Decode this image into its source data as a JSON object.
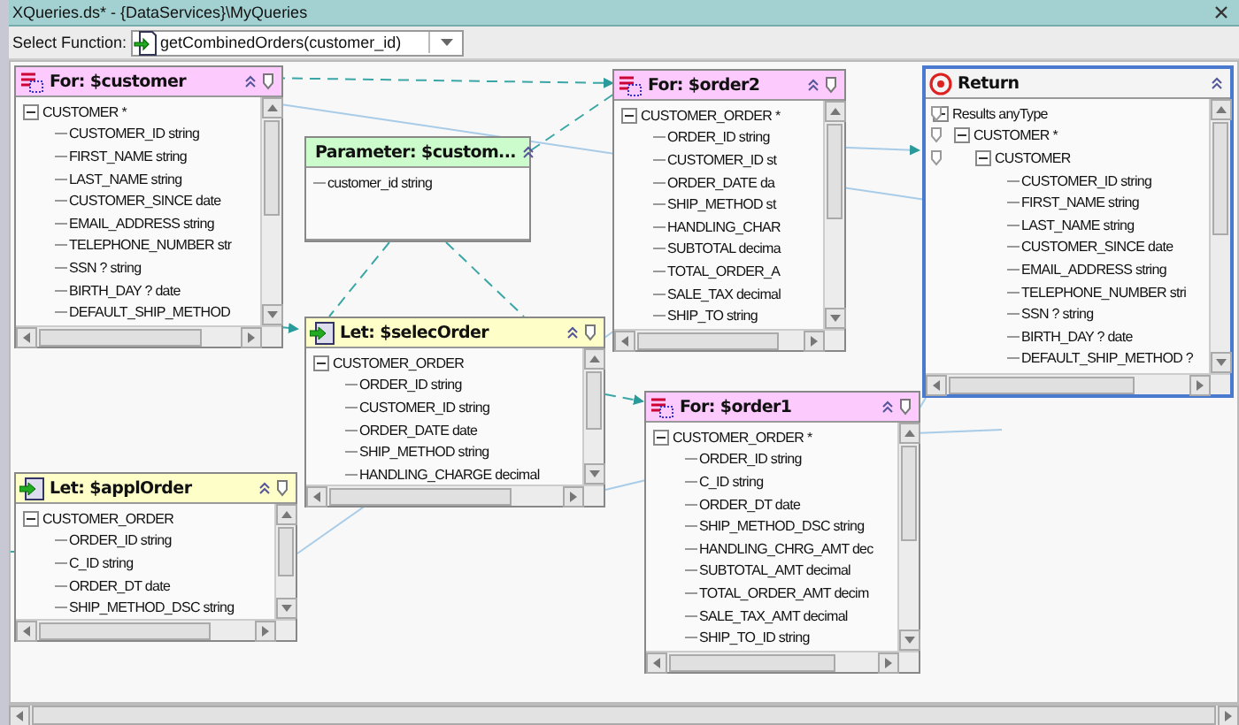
{
  "window": {
    "title": "XQueries.ds* - {DataServices}\\MyQueries"
  },
  "toolbar": {
    "label": "Select Function:",
    "function": "getCombinedOrders(customer_id)"
  },
  "nodes": [
    {
      "kind": "for",
      "title": "For: $customer",
      "tree": [
        {
          "label": "CUSTOMER *",
          "expanded": true,
          "children": [
            {
              "label": "CUSTOMER_ID string"
            },
            {
              "label": "FIRST_NAME string"
            },
            {
              "label": "LAST_NAME string"
            },
            {
              "label": "CUSTOMER_SINCE date"
            },
            {
              "label": "EMAIL_ADDRESS string"
            },
            {
              "label": "TELEPHONE_NUMBER str"
            },
            {
              "label": "SSN ? string"
            },
            {
              "label": "BIRTH_DAY ? date"
            },
            {
              "label": "DEFAULT_SHIP_METHOD"
            }
          ]
        }
      ]
    },
    {
      "kind": "parameter",
      "title": "Parameter: $custom...",
      "tree": [
        {
          "label": "customer_id string"
        }
      ]
    },
    {
      "kind": "let",
      "title": "Let: $selecOrder",
      "tree": [
        {
          "label": "CUSTOMER_ORDER",
          "expanded": true,
          "children": [
            {
              "label": "ORDER_ID string"
            },
            {
              "label": "CUSTOMER_ID string"
            },
            {
              "label": "ORDER_DATE date"
            },
            {
              "label": "SHIP_METHOD string"
            },
            {
              "label": "HANDLING_CHARGE decimal"
            }
          ]
        }
      ]
    },
    {
      "kind": "let",
      "title": "Let: $applOrder",
      "tree": [
        {
          "label": "CUSTOMER_ORDER",
          "expanded": true,
          "children": [
            {
              "label": "ORDER_ID string"
            },
            {
              "label": "C_ID string"
            },
            {
              "label": "ORDER_DT date"
            },
            {
              "label": "SHIP_METHOD_DSC string"
            }
          ]
        }
      ]
    },
    {
      "kind": "for",
      "title": "For: $order2",
      "tree": [
        {
          "label": "CUSTOMER_ORDER *",
          "expanded": true,
          "children": [
            {
              "label": "ORDER_ID string"
            },
            {
              "label": "CUSTOMER_ID st"
            },
            {
              "label": "ORDER_DATE da"
            },
            {
              "label": "SHIP_METHOD st"
            },
            {
              "label": "HANDLING_CHAR"
            },
            {
              "label": "SUBTOTAL decima"
            },
            {
              "label": "TOTAL_ORDER_A"
            },
            {
              "label": "SALE_TAX decimal"
            },
            {
              "label": "SHIP_TO string"
            }
          ]
        }
      ]
    },
    {
      "kind": "return",
      "title": "Return",
      "tree": [
        {
          "label": "Results anyType",
          "expanded": true,
          "children": [
            {
              "label": "CUSTOMER *",
              "expanded": true,
              "children": [
                {
                  "label": "CUSTOMER",
                  "expanded": true,
                  "children": [
                    {
                      "label": "CUSTOMER_ID string"
                    },
                    {
                      "label": "FIRST_NAME string"
                    },
                    {
                      "label": "LAST_NAME string"
                    },
                    {
                      "label": "CUSTOMER_SINCE date"
                    },
                    {
                      "label": "EMAIL_ADDRESS string"
                    },
                    {
                      "label": "TELEPHONE_NUMBER stri"
                    },
                    {
                      "label": "SSN ? string"
                    },
                    {
                      "label": "BIRTH_DAY ? date"
                    },
                    {
                      "label": "DEFAULT_SHIP_METHOD ?"
                    }
                  ]
                }
              ]
            }
          ]
        }
      ]
    },
    {
      "kind": "for",
      "title": "For: $order1",
      "tree": [
        {
          "label": "CUSTOMER_ORDER *",
          "expanded": true,
          "children": [
            {
              "label": "ORDER_ID string"
            },
            {
              "label": "C_ID string"
            },
            {
              "label": "ORDER_DT date"
            },
            {
              "label": "SHIP_METHOD_DSC string"
            },
            {
              "label": "HANDLING_CHRG_AMT dec"
            },
            {
              "label": "SUBTOTAL_AMT decimal"
            },
            {
              "label": "TOTAL_ORDER_AMT decim"
            },
            {
              "label": "SALE_TAX_AMT decimal"
            },
            {
              "label": "SHIP_TO_ID string"
            }
          ]
        }
      ]
    }
  ]
}
